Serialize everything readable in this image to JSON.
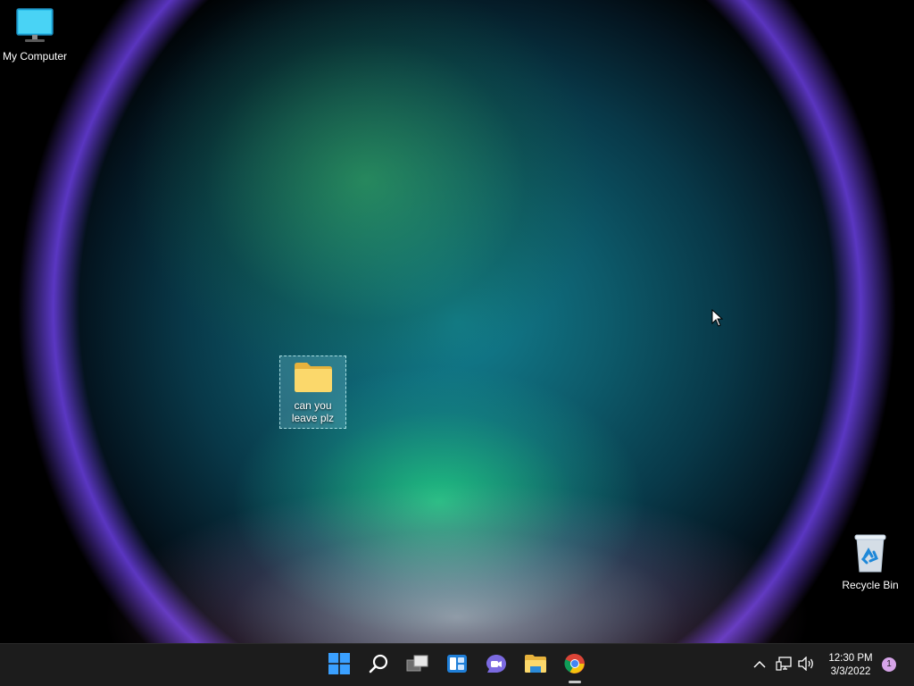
{
  "desktop": {
    "icons": {
      "my_computer": {
        "label": "My Computer",
        "icon": "monitor-icon"
      },
      "folder": {
        "label": "can you leave plz",
        "icon": "folder-icon",
        "selected": true
      },
      "recycle_bin": {
        "label": "Recycle Bin",
        "icon": "recycle-bin-icon"
      }
    }
  },
  "taskbar": {
    "apps": [
      {
        "name": "Start",
        "icon": "windows-start-icon"
      },
      {
        "name": "Search",
        "icon": "search-icon"
      },
      {
        "name": "Task View",
        "icon": "task-view-icon"
      },
      {
        "name": "Widgets",
        "icon": "widgets-icon"
      },
      {
        "name": "Chat",
        "icon": "chat-icon"
      },
      {
        "name": "File Explorer",
        "icon": "file-explorer-icon"
      },
      {
        "name": "Google Chrome",
        "icon": "chrome-icon",
        "active": true
      }
    ],
    "tray": {
      "overflow_icon": "chevron-up-icon",
      "network_icon": "network-icon",
      "volume_icon": "volume-icon",
      "time": "12:30 PM",
      "date": "3/3/2022",
      "notification_count": "1"
    }
  },
  "colors": {
    "taskbar_bg": "#1c1c1c",
    "start_blue": "#3aa0ff",
    "folder_yellow": "#f8d46a",
    "notif_badge": "#d6a4e8"
  }
}
